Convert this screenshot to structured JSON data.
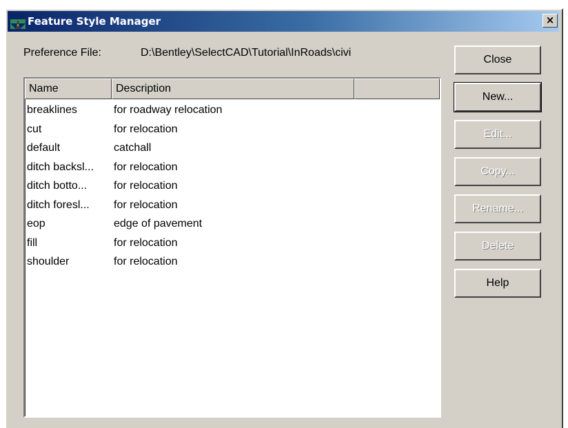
{
  "window": {
    "title": "Feature Style Manager",
    "close_glyph": "×"
  },
  "preference": {
    "label": "Preference File:",
    "value": "D:\\Bentley\\SelectCAD\\Tutorial\\InRoads\\civi"
  },
  "list": {
    "columns": [
      "Name",
      "Description",
      ""
    ],
    "rows": [
      {
        "name": "breaklines",
        "description": "for roadway relocation"
      },
      {
        "name": "cut",
        "description": "for relocation"
      },
      {
        "name": "default",
        "description": "catchall"
      },
      {
        "name": "ditch backsl...",
        "description": "for relocation"
      },
      {
        "name": "ditch botto...",
        "description": "for relocation"
      },
      {
        "name": "ditch foresl...",
        "description": "for relocation"
      },
      {
        "name": "eop",
        "description": "edge of pavement"
      },
      {
        "name": "fill",
        "description": "for relocation"
      },
      {
        "name": "shoulder",
        "description": "for relocation"
      }
    ]
  },
  "buttons": {
    "close": "Close",
    "new": "New...",
    "edit": "Edit...",
    "copy": "Copy...",
    "rename": "Rename...",
    "delete": "Delete",
    "help": "Help"
  },
  "icons": {
    "app": "road-icon",
    "close": "close-icon"
  },
  "colors": {
    "title_start": "#0a246a",
    "title_end": "#a6caf0",
    "face": "#d4d0c8"
  }
}
